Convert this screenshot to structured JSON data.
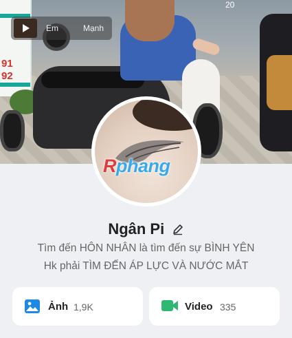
{
  "cover": {
    "media_player": {
      "song_title": "Em",
      "song_artist": "Mạnh"
    },
    "top_right_partial_text": "20",
    "shop_sign_text_line1": "91",
    "shop_sign_text_line2": "92"
  },
  "watermark": {
    "prefix": "R",
    "rest": "phang"
  },
  "profile": {
    "name": "Ngân Pi",
    "bio_line1": "Tìm đến HÔN NHÂN là tìm đến sự BÌNH YÊN",
    "bio_line2": "Hk phải TÌM ĐẾN ÁP LỰC VÀ NƯỚC MẮT"
  },
  "cards": [
    {
      "label": "Ảnh",
      "count": "1,9K",
      "icon": "photo-icon",
      "color": "#1e88e5"
    },
    {
      "label": "Video",
      "count": "335",
      "icon": "video-icon",
      "color": "#2eb872"
    }
  ]
}
